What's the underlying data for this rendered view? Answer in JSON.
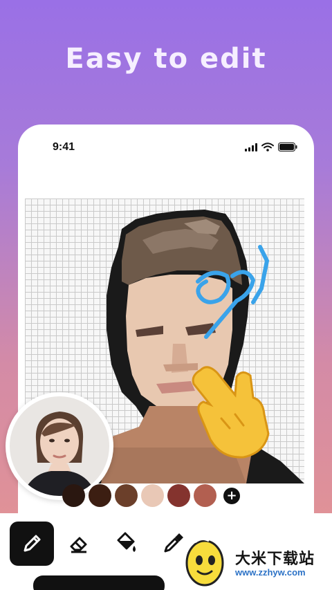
{
  "headline": "Easy to edit",
  "status_bar": {
    "time": "9:41"
  },
  "palette": {
    "colors": [
      "#d6d6d6",
      "#2a1710",
      "#3c1e12",
      "#6b3f2a",
      "#e9c8b6",
      "#84332e",
      "#b25f50"
    ],
    "add_symbol": "+"
  },
  "toolbar": {
    "tools": [
      {
        "name": "pencil",
        "icon": "pencil-icon",
        "active": true
      },
      {
        "name": "eraser",
        "icon": "eraser-icon",
        "active": false
      },
      {
        "name": "fill",
        "icon": "paint-bucket-icon",
        "active": false
      },
      {
        "name": "eyedropper",
        "icon": "eyedropper-icon",
        "active": false
      }
    ]
  },
  "watermark": {
    "title": "大米下载站",
    "url": "www.zzhyw.com"
  }
}
